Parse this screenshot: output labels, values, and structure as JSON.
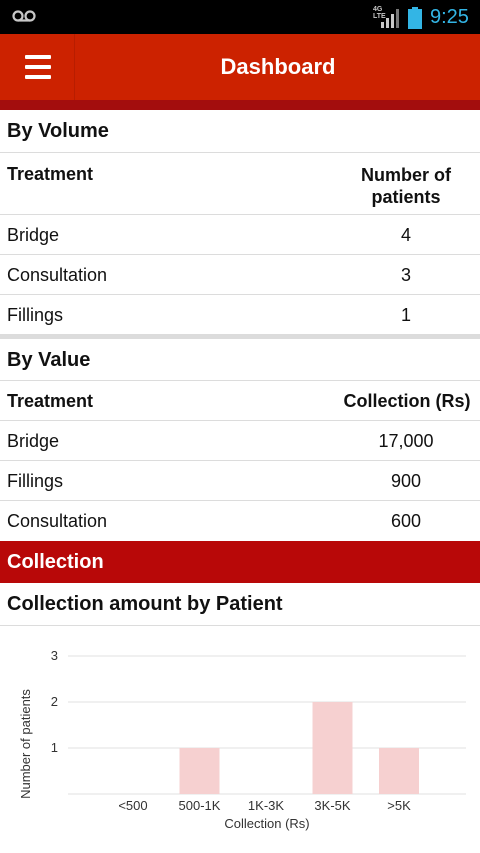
{
  "status_bar": {
    "network": [
      "4G",
      "LTE"
    ],
    "time": "9:25",
    "icons": [
      "voicemail-icon",
      "signal-icon",
      "battery-icon"
    ]
  },
  "app_bar": {
    "title": "Dashboard",
    "menu_icon": "hamburger-menu-icon",
    "color": "#cc2200"
  },
  "by_volume": {
    "title": "By Volume",
    "columns": [
      "Treatment",
      "Number of patients"
    ],
    "rows": [
      {
        "treatment": "Bridge",
        "value": "4"
      },
      {
        "treatment": "Consultation",
        "value": "3"
      },
      {
        "treatment": "Fillings",
        "value": "1"
      }
    ]
  },
  "by_value": {
    "title": "By Value",
    "columns": [
      "Treatment",
      "Collection (Rs)"
    ],
    "rows": [
      {
        "treatment": "Bridge",
        "value": "17,000"
      },
      {
        "treatment": "Fillings",
        "value": "900"
      },
      {
        "treatment": "Consultation",
        "value": "600"
      }
    ]
  },
  "collection": {
    "bar_title": "Collection",
    "bar_color": "#b80808",
    "chart_title": "Collection amount by Patient"
  },
  "chart_data": {
    "type": "bar",
    "title": "Collection amount by Patient",
    "categories": [
      "<500",
      "500-1K",
      "1K-3K",
      "3K-5K",
      ">5K"
    ],
    "values": [
      0,
      1,
      0,
      2,
      1
    ],
    "xlabel": "Collection (Rs)",
    "ylabel": "Number of patients",
    "ylim": [
      0,
      3
    ],
    "yticks": [
      1,
      2,
      3
    ],
    "grid": true,
    "bar_color": "#f6d0d0"
  }
}
